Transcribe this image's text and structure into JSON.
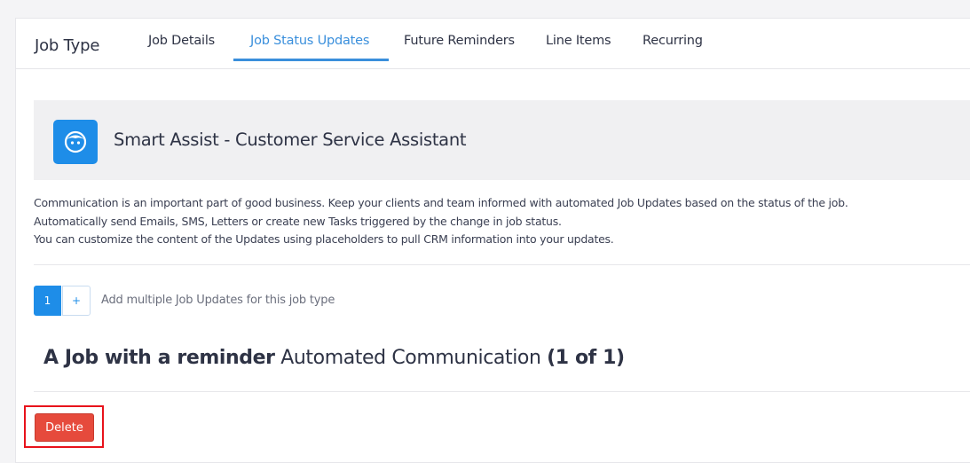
{
  "header": {
    "title": "Job Type",
    "tabs": [
      {
        "label": "Job Details"
      },
      {
        "label": "Job Status Updates"
      },
      {
        "label": "Future Reminders"
      },
      {
        "label": "Line Items"
      },
      {
        "label": "Recurring"
      }
    ],
    "active_tab": "Job Status Updates",
    "accent_color": "#3a8fdc"
  },
  "assistant": {
    "icon": "robot-face-icon",
    "title": "Smart Assist - Customer Service Assistant"
  },
  "description": [
    "Communication is an important part of good business. Keep your clients and team informed with automated Job Updates based on the status of the job.",
    "Automatically send Emails, SMS, Letters or create new Tasks triggered by the change in job status.",
    "You can customize the content of the Updates using placeholders to pull CRM information into your updates."
  ],
  "pagination": {
    "current_page": "1",
    "add_label": "+",
    "hint": "Add multiple Job Updates for this job type"
  },
  "update_section": {
    "name": "A Job with a reminder",
    "label": "Automated Communication",
    "count": "(1 of 1)"
  },
  "actions": {
    "delete_label": "Delete",
    "delete_color": "#e64a3c"
  }
}
